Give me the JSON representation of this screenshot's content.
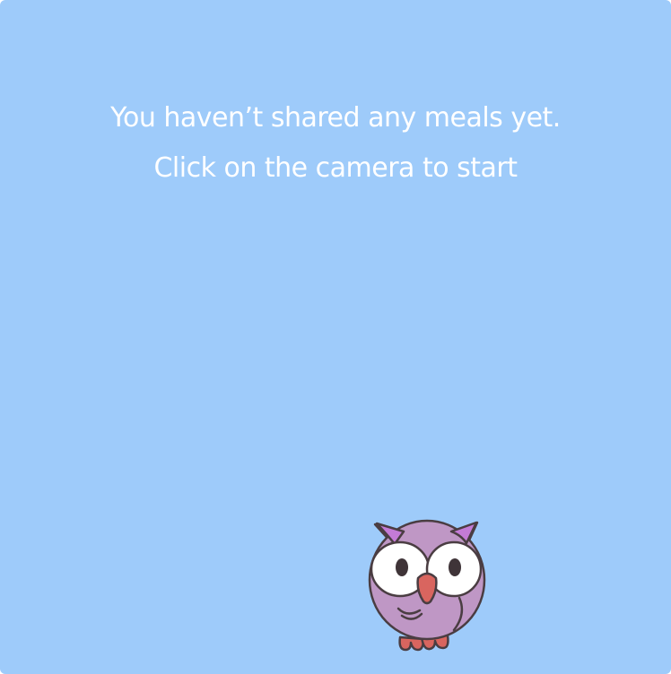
{
  "empty_state": {
    "line1": "You haven’t shared any meals yet.",
    "line2": "Click on the camera to start"
  },
  "colors": {
    "background": "#9ecbfa",
    "text": "#ffffff",
    "owl_body": "#bf97c5",
    "owl_tufts": "#c47bd6",
    "owl_beak": "#d9655f",
    "owl_feet": "#d9655f",
    "outline": "#4a3d42"
  },
  "illustration": {
    "icon": "owl-mascot-icon"
  }
}
